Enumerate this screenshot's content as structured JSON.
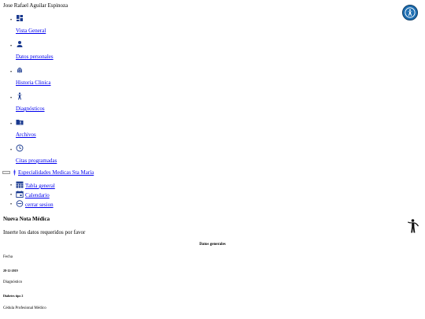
{
  "header": {
    "user_name": "Jose Rafael Aguilar Espinoza",
    "accessibility_icon": "accessibility-icon"
  },
  "sidebar": {
    "items": [
      {
        "label": "Vista General",
        "icon": "dashboard-icon"
      },
      {
        "label": "Datos personales",
        "icon": "person-icon"
      },
      {
        "label": "Historia Clinica",
        "icon": "fingerprint-icon"
      },
      {
        "label": "Diagnósticos",
        "icon": "accessibility-person-icon"
      },
      {
        "label": "Archivos",
        "icon": "folder-account-icon"
      },
      {
        "label": "Citas programadas",
        "icon": "clock-icon"
      }
    ]
  },
  "topbar": {
    "brand_label": "Especialidades Medicas Sta María",
    "items": [
      {
        "label": "Tabla general",
        "icon": "table-icon"
      },
      {
        "label": "Calendario",
        "icon": "calendar-icon"
      },
      {
        "label": "cerrar sesion",
        "icon": "logout-icon"
      }
    ]
  },
  "form": {
    "title": "Nueva Nota Médica",
    "subtitle": "Inserte los datos requeridos por favor",
    "section_heading": "Datos generales",
    "fields": [
      {
        "label": "Fecha",
        "value": "28-12-2019"
      },
      {
        "label": "Diagnóstico",
        "value": "Diabetes tipo 2"
      },
      {
        "label": "Cédula Profesional Médico",
        "value": ""
      }
    ],
    "side_icon": "person-standing-icon"
  },
  "colors": {
    "link": "#0000ee",
    "accessibility_button": "#1f6fb2"
  }
}
